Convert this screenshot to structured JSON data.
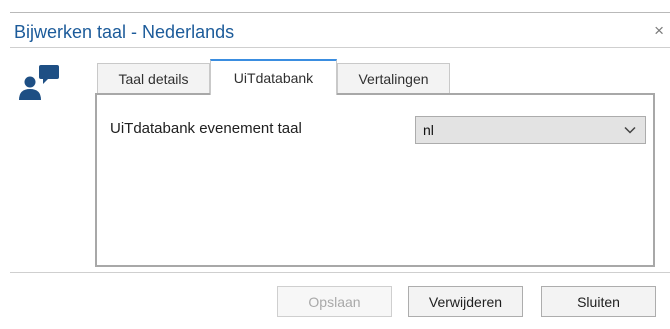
{
  "window": {
    "title": "Bijwerken taal - Nederlands",
    "close_glyph": "×"
  },
  "icons": {
    "app_icon": "user-chat-icon",
    "close": "close-icon",
    "dropdown": "chevron-down-icon"
  },
  "tabs": [
    {
      "label": "Taal details",
      "active": false
    },
    {
      "label": "UiTdatabank",
      "active": true
    },
    {
      "label": "Vertalingen",
      "active": false
    }
  ],
  "form": {
    "field_label": "UiTdatabank evenement taal",
    "select_value": "nl"
  },
  "buttons": {
    "save": "Opslaan",
    "delete": "Verwijderen",
    "close": "Sluiten"
  },
  "colors": {
    "title": "#1c5b9a",
    "icon": "#1e4f84",
    "active_tab_accent": "#3a8de0"
  }
}
